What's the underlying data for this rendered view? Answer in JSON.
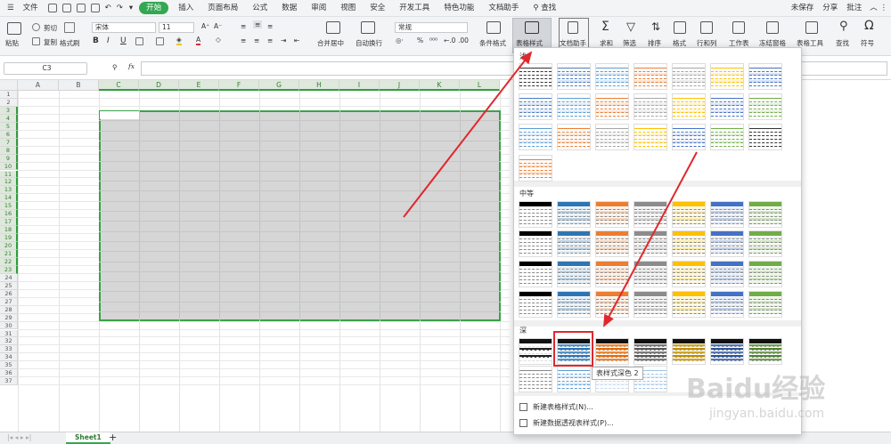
{
  "menu": {
    "file": "文件",
    "items": [
      "开始",
      "插入",
      "页面布局",
      "公式",
      "数据",
      "审阅",
      "视图",
      "安全",
      "开发工具",
      "特色功能",
      "文档助手"
    ],
    "active": "开始",
    "search": "查找",
    "right": [
      "未保存",
      "分享",
      "批注"
    ]
  },
  "ribbon": {
    "paste": "粘贴",
    "cut": "剪切",
    "copy": "复制",
    "format_painter": "格式刷",
    "font": "宋体",
    "size": "11",
    "number_format": "常规",
    "merge": "合并居中",
    "wrap": "自动换行",
    "cond_format": "条件格式",
    "table_style": "表格样式",
    "doc_helper": "文档助手",
    "sum": "求和",
    "filter": "筛选",
    "sort": "排序",
    "format": "格式",
    "rowcol": "行和列",
    "sheet": "工作表",
    "freeze": "冻结窗格",
    "table_tools": "表格工具",
    "find": "查找",
    "symbol": "符号"
  },
  "formula": {
    "namebox": "C3",
    "fx": "fx"
  },
  "columns": [
    "A",
    "B",
    "C",
    "D",
    "E",
    "F",
    "G",
    "H",
    "I",
    "J",
    "K",
    "L"
  ],
  "rows": [
    "1",
    "2",
    "3",
    "4",
    "5",
    "6",
    "7",
    "8",
    "9",
    "10",
    "11",
    "12",
    "13",
    "14",
    "15",
    "16",
    "17",
    "18",
    "19",
    "20",
    "21",
    "22",
    "23",
    "24",
    "25",
    "26",
    "27",
    "28",
    "29",
    "30",
    "31",
    "32",
    "33",
    "34",
    "35",
    "36",
    "37"
  ],
  "sheet_tab": "Sheet1",
  "dropdown": {
    "light": "浅",
    "medium": "中等",
    "dark": "深",
    "new_table_style": "新建表格样式(N)...",
    "new_pivot_style": "新建数据透视表样式(P)...",
    "tooltip": "表样式深色 2"
  },
  "watermark": {
    "brand": "Baidu",
    "brand_cn": "经验",
    "url": "jingyan.baidu.com"
  },
  "colors": {
    "accent": "#33a852",
    "selection": "#3aa14a",
    "arrow": "#e0282e"
  }
}
